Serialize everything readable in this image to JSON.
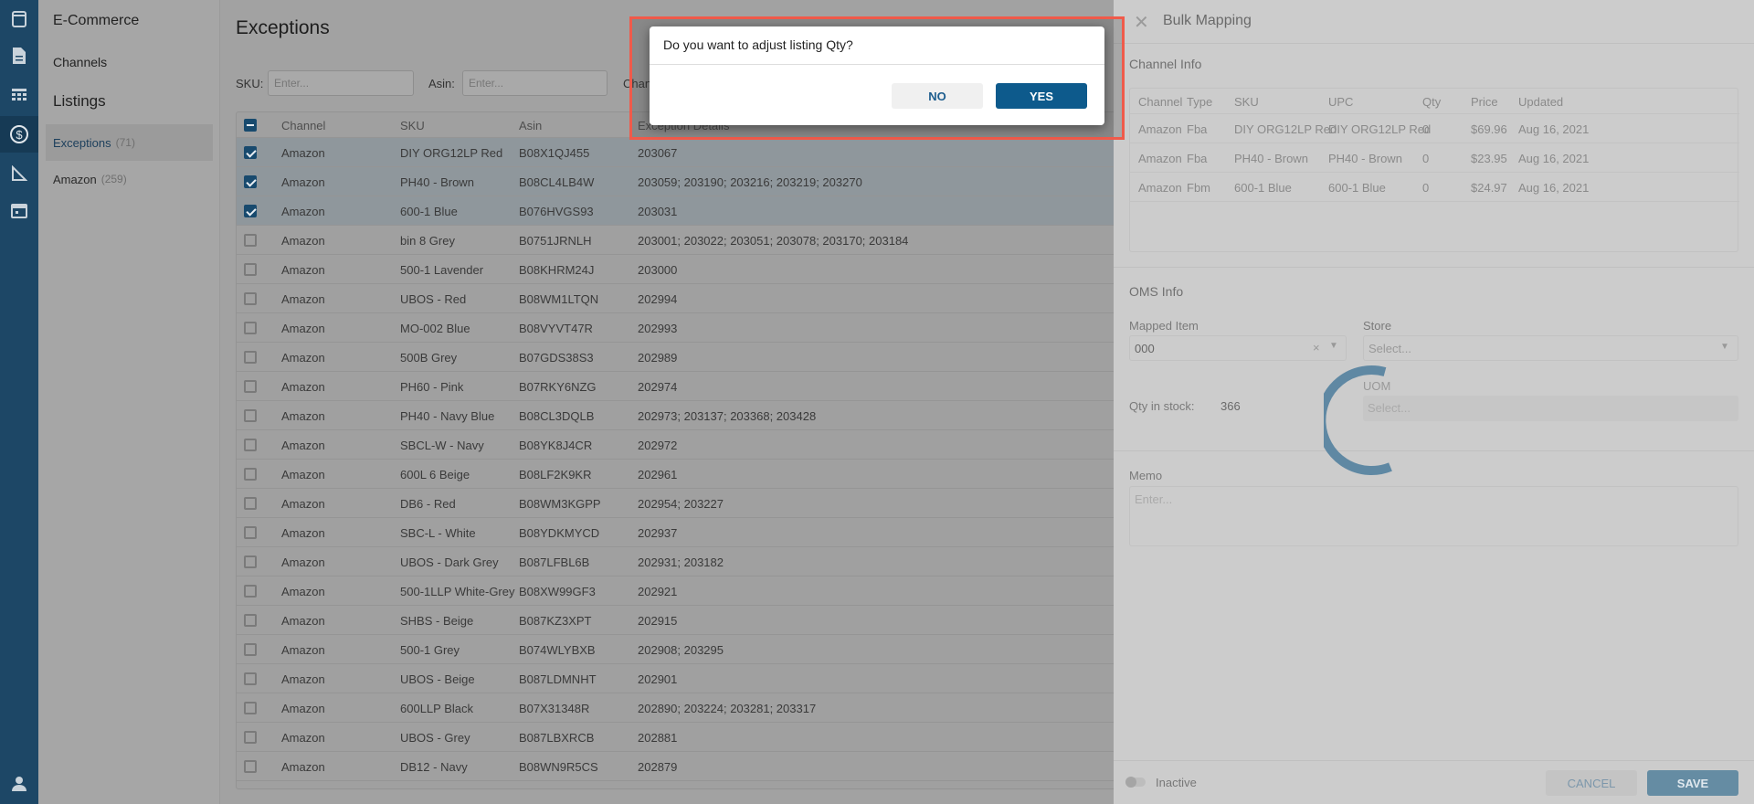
{
  "sidebar": {
    "title": "E-Commerce",
    "channels": "Channels",
    "listings": "Listings",
    "items": [
      {
        "label": "Exceptions",
        "count": "(71)"
      },
      {
        "label": "Amazon",
        "count": "(259)"
      }
    ]
  },
  "main": {
    "title": "Exceptions",
    "filters": {
      "sku_label": "SKU:",
      "sku_placeholder": "Enter...",
      "asin_label": "Asin:",
      "asin_placeholder": "Enter...",
      "channel_label": "Chan"
    },
    "columns": [
      "Channel",
      "SKU",
      "Asin",
      "Exception Details"
    ],
    "rows": [
      {
        "checked": true,
        "channel": "Amazon",
        "sku": "DIY ORG12LP Red",
        "asin": "B08X1QJ455",
        "details": "203067"
      },
      {
        "checked": true,
        "channel": "Amazon",
        "sku": "PH40 - Brown",
        "asin": "B08CL4LB4W",
        "details": "203059; 203190; 203216; 203219; 203270"
      },
      {
        "checked": true,
        "channel": "Amazon",
        "sku": "600-1 Blue",
        "asin": "B076HVGS93",
        "details": "203031"
      },
      {
        "checked": false,
        "channel": "Amazon",
        "sku": "bin 8 Grey",
        "asin": "B0751JRNLH",
        "details": "203001; 203022; 203051; 203078; 203170; 203184"
      },
      {
        "checked": false,
        "channel": "Amazon",
        "sku": "500-1 Lavender",
        "asin": "B08KHRM24J",
        "details": "203000"
      },
      {
        "checked": false,
        "channel": "Amazon",
        "sku": "UBOS - Red",
        "asin": "B08WM1LTQN",
        "details": "202994"
      },
      {
        "checked": false,
        "channel": "Amazon",
        "sku": "MO-002 Blue",
        "asin": "B08VYVT47R",
        "details": "202993"
      },
      {
        "checked": false,
        "channel": "Amazon",
        "sku": "500B Grey",
        "asin": "B07GDS38S3",
        "details": "202989"
      },
      {
        "checked": false,
        "channel": "Amazon",
        "sku": "PH60 - Pink",
        "asin": "B07RKY6NZG",
        "details": "202974"
      },
      {
        "checked": false,
        "channel": "Amazon",
        "sku": "PH40 - Navy Blue",
        "asin": "B08CL3DQLB",
        "details": "202973; 203137; 203368; 203428"
      },
      {
        "checked": false,
        "channel": "Amazon",
        "sku": "SBCL-W - Navy",
        "asin": "B08YK8J4CR",
        "details": "202972"
      },
      {
        "checked": false,
        "channel": "Amazon",
        "sku": "600L 6 Beige",
        "asin": "B08LF2K9KR",
        "details": "202961"
      },
      {
        "checked": false,
        "channel": "Amazon",
        "sku": "DB6 - Red",
        "asin": "B08WM3KGPP",
        "details": "202954; 203227"
      },
      {
        "checked": false,
        "channel": "Amazon",
        "sku": "SBC-L - White",
        "asin": "B08YDKMYCD",
        "details": "202937"
      },
      {
        "checked": false,
        "channel": "Amazon",
        "sku": "UBOS - Dark Grey",
        "asin": "B087LFBL6B",
        "details": "202931; 203182"
      },
      {
        "checked": false,
        "channel": "Amazon",
        "sku": "500-1LLP White-Grey",
        "asin": "B08XW99GF3",
        "details": "202921"
      },
      {
        "checked": false,
        "channel": "Amazon",
        "sku": "SHBS - Beige",
        "asin": "B087KZ3XPT",
        "details": "202915"
      },
      {
        "checked": false,
        "channel": "Amazon",
        "sku": "500-1 Grey",
        "asin": "B074WLYBXB",
        "details": "202908; 203295"
      },
      {
        "checked": false,
        "channel": "Amazon",
        "sku": "UBOS - Beige",
        "asin": "B087LDMNHT",
        "details": "202901"
      },
      {
        "checked": false,
        "channel": "Amazon",
        "sku": "600LLP Black",
        "asin": "B07X31348R",
        "details": "202890; 203224; 203281; 203317"
      },
      {
        "checked": false,
        "channel": "Amazon",
        "sku": "UBOS - Grey",
        "asin": "B087LBXRCB",
        "details": "202881"
      },
      {
        "checked": false,
        "channel": "Amazon",
        "sku": "DB12 - Navy",
        "asin": "B08WN9R5CS",
        "details": "202879"
      }
    ]
  },
  "panel": {
    "title": "Bulk Mapping",
    "channel_info": "Channel Info",
    "channel_columns": [
      "Channel",
      "Type",
      "SKU",
      "UPC",
      "Qty",
      "Price",
      "Updated"
    ],
    "channel_rows": [
      [
        "Amazon",
        "Fba",
        "DIY ORG12LP Red",
        "DIY ORG12LP Red",
        "0",
        "$69.96",
        "Aug 16, 2021"
      ],
      [
        "Amazon",
        "Fba",
        "PH40 - Brown",
        "PH40 - Brown",
        "0",
        "$23.95",
        "Aug 16, 2021"
      ],
      [
        "Amazon",
        "Fbm",
        "600-1 Blue",
        "600-1 Blue",
        "0",
        "$24.97",
        "Aug 16, 2021"
      ]
    ],
    "oms_info": "OMS Info",
    "mapped_item_label": "Mapped Item",
    "mapped_item_value": "000",
    "store_label": "Store",
    "store_placeholder": "Select...",
    "uom_label": "UOM",
    "uom_placeholder": "Select...",
    "qty_label": "Qty in stock:",
    "qty_value": "366",
    "memo_label": "Memo",
    "memo_placeholder": "Enter...",
    "inactive_label": "Inactive",
    "cancel": "CANCEL",
    "save": "SAVE"
  },
  "dialog": {
    "message": "Do you want to adjust listing Qty?",
    "no": "NO",
    "yes": "YES"
  },
  "colors": {
    "brand": "#0d5a8c",
    "highlight": "#f05a4a"
  }
}
